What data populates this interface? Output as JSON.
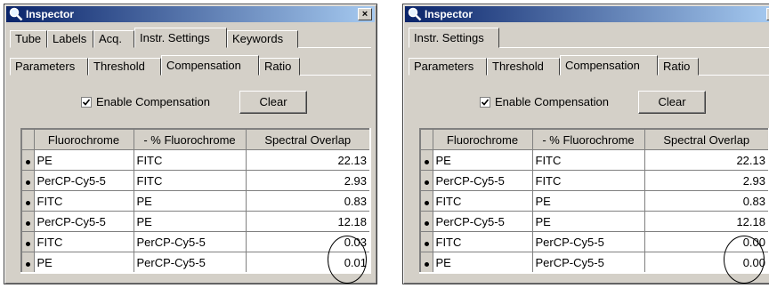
{
  "left": {
    "title": "Inspector",
    "close_glyph": "×",
    "tabs_top": [
      "Tube",
      "Labels",
      "Acq.",
      "Instr. Settings",
      "Keywords"
    ],
    "tabs_sub": [
      "Parameters",
      "Threshold",
      "Compensation",
      "Ratio"
    ],
    "enable_label": "Enable Compensation",
    "enable_checked": true,
    "clear_label": "Clear",
    "headers": [
      "Fluorochrome",
      "- % Fluorochrome",
      "Spectral Overlap"
    ],
    "rows": [
      {
        "fluor": "PE",
        "minus": "FITC",
        "overlap": "22.13"
      },
      {
        "fluor": "PerCP-Cy5-5",
        "minus": "FITC",
        "overlap": "2.93"
      },
      {
        "fluor": "FITC",
        "minus": "PE",
        "overlap": "0.83"
      },
      {
        "fluor": "PerCP-Cy5-5",
        "minus": "PE",
        "overlap": "12.18"
      },
      {
        "fluor": "FITC",
        "minus": "PerCP-Cy5-5",
        "overlap": "0.03"
      },
      {
        "fluor": "PE",
        "minus": "PerCP-Cy5-5",
        "overlap": "0.01"
      }
    ]
  },
  "right": {
    "title": "Inspector",
    "close_glyph": "×",
    "tabs_top": [
      "Instr. Settings"
    ],
    "tabs_sub": [
      "Parameters",
      "Threshold",
      "Compensation",
      "Ratio"
    ],
    "enable_label": "Enable Compensation",
    "enable_checked": true,
    "clear_label": "Clear",
    "headers": [
      "Fluorochrome",
      "- % Fluorochrome",
      "Spectral Overlap"
    ],
    "rows": [
      {
        "fluor": "PE",
        "minus": "FITC",
        "overlap": "22.13"
      },
      {
        "fluor": "PerCP-Cy5-5",
        "minus": "FITC",
        "overlap": "2.93"
      },
      {
        "fluor": "FITC",
        "minus": "PE",
        "overlap": "0.83"
      },
      {
        "fluor": "PerCP-Cy5-5",
        "minus": "PE",
        "overlap": "12.18"
      },
      {
        "fluor": "FITC",
        "minus": "PerCP-Cy5-5",
        "overlap": "0.00"
      },
      {
        "fluor": "PE",
        "minus": "PerCP-Cy5-5",
        "overlap": "0.00"
      }
    ]
  },
  "colors": {
    "titlebar": "#0a246a",
    "face": "#d4d0c8"
  },
  "icons": {
    "title": "magnifier-icon",
    "close": "close-icon",
    "check": "checkmark-icon",
    "row_selector": "row-selector-dot-icon"
  }
}
